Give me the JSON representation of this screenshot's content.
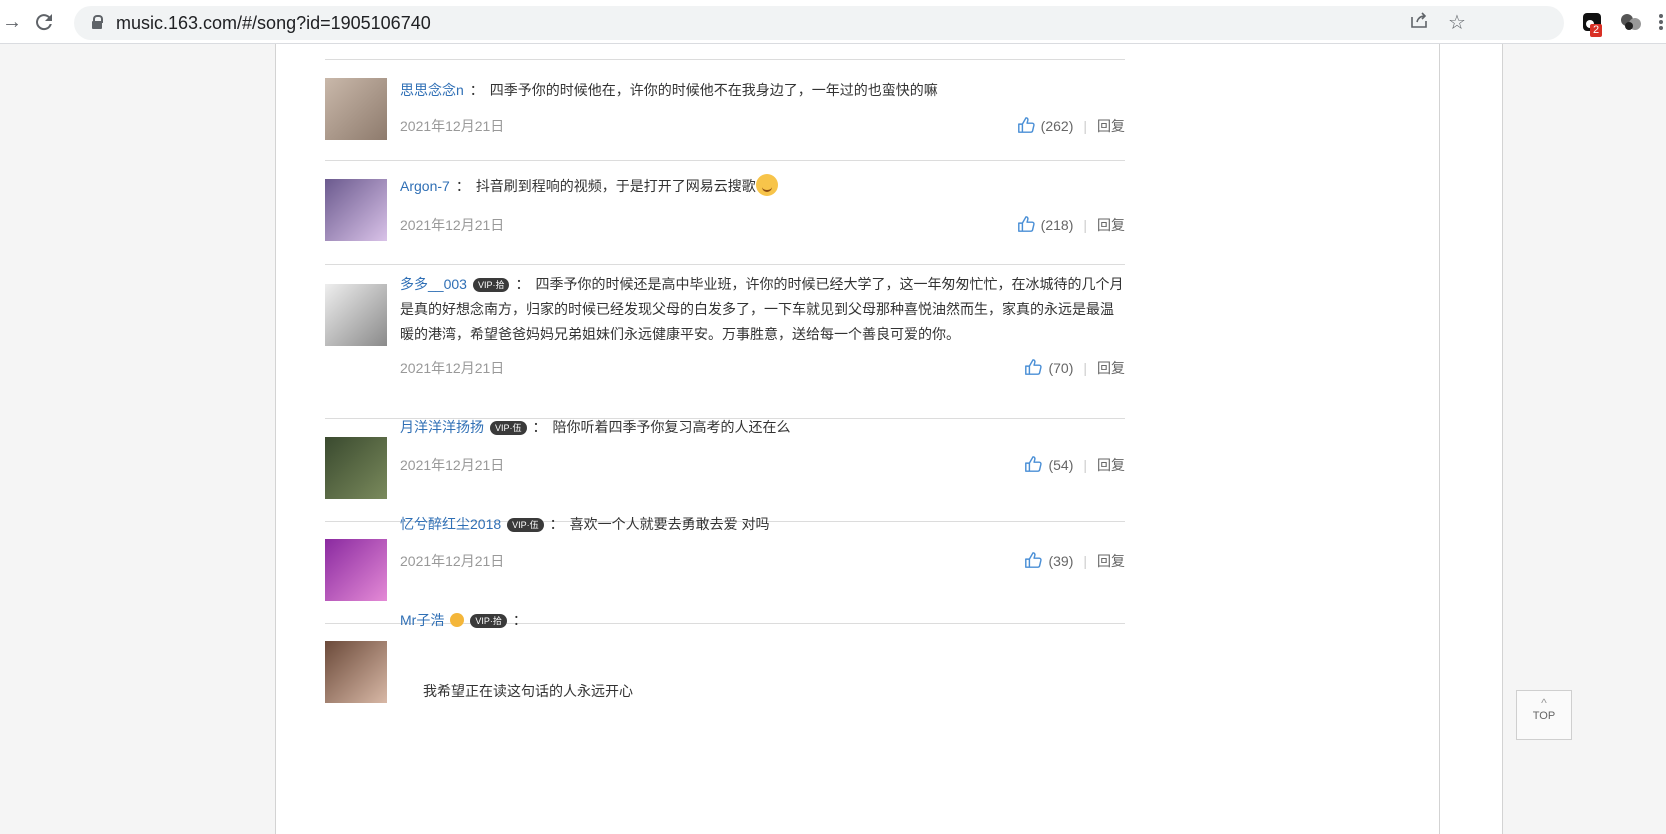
{
  "browser": {
    "url": "music.163.com/#/song?id=1905106740",
    "extension_badge": "2"
  },
  "comments": [
    {
      "user": "思思念念n",
      "vip": "",
      "text": "四季予你的时候他在，许你的时候他不在我身边了，一年过的也蛮快的嘛",
      "date": "2021年12月21日",
      "likes": "(262)",
      "reply": "回复"
    },
    {
      "user": "Argon-7",
      "vip": "",
      "text": "抖音刷到程响的视频，于是打开了网易云搜歌",
      "date": "2021年12月21日",
      "likes": "(218)",
      "reply": "回复"
    },
    {
      "user": "多多__003",
      "vip": "VIP·拾",
      "text": "四季予你的时候还是高中毕业班，许你的时候已经大学了，这一年匆匆忙忙，在冰城待的几个月是真的好想念南方，归家的时候已经发现父母的白发多了，一下车就见到父母那种喜悦油然而生，家真的永远是最温暖的港湾，希望爸爸妈妈兄弟姐妹们永远健康平安。万事胜意，送给每一个善良可爱的你。",
      "date": "2021年12月21日",
      "likes": "(70)",
      "reply": "回复"
    },
    {
      "user": "月洋洋洋扬扬",
      "vip": "VIP·伍",
      "text": "陪你听着四季予你复习高考的人还在么",
      "date": "2021年12月21日",
      "likes": "(54)",
      "reply": "回复"
    },
    {
      "user": "忆兮醉红尘2018",
      "vip": "VIP·伍",
      "text": "喜欢一个人就要去勇敢去爱 对吗",
      "date": "2021年12月21日",
      "likes": "(39)",
      "reply": "回复"
    },
    {
      "user": "Mr子浩",
      "vip": "VIP·拾",
      "text": "",
      "quote": "我希望正在读这句话的人永远开心"
    }
  ],
  "top_button": "TOP",
  "colors": {
    "link": "#2f6fb5",
    "text": "#333333",
    "date": "#999999"
  }
}
